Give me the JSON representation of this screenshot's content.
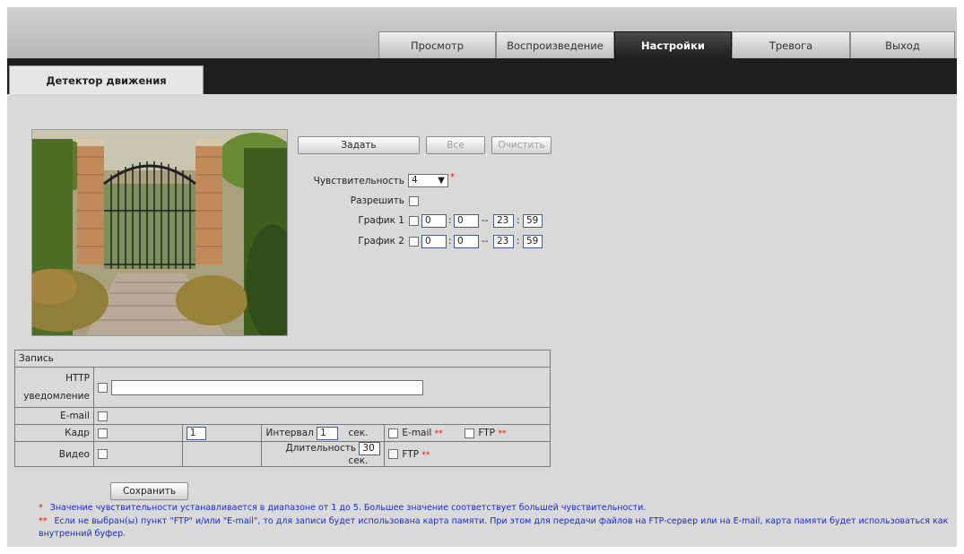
{
  "nav": {
    "tabs": [
      {
        "label": "Просмотр"
      },
      {
        "label": "Воспроизведение"
      },
      {
        "label": "Настройки"
      },
      {
        "label": "Тревога"
      },
      {
        "label": "Выход"
      }
    ],
    "active": "Настройки"
  },
  "page": {
    "tab": "Детектор движения"
  },
  "region_buttons": {
    "set": "Задать",
    "all": "Все",
    "clear": "Очистить"
  },
  "form": {
    "sensitivity_label": "Чувствительность",
    "sensitivity_value": "4",
    "sensitivity_marker": "*",
    "enable_label": "Разрешить",
    "schedule1_label": "График 1",
    "schedule2_label": "График 2",
    "schedule1": {
      "start_h": "0",
      "start_m": "0",
      "end_h": "23",
      "end_m": "59"
    },
    "schedule2": {
      "start_h": "0",
      "start_m": "0",
      "end_h": "23",
      "end_m": "59"
    },
    "colon": ":",
    "dash": "--"
  },
  "record": {
    "header": "Запись",
    "http_label_1": "HTTP",
    "http_label_2": "уведомление",
    "http_value": "",
    "email_label": "E-mail",
    "frame_label": "Кадр",
    "frame_count": "1",
    "interval_label": "Интервал",
    "interval_value": "1",
    "sec": "сек.",
    "email_opt": "E-mail",
    "ftp_opt": "FTP",
    "double_marker": "**",
    "video_label": "Видео",
    "duration_label": "Длительность",
    "duration_value": "30"
  },
  "save_button": "Сохранить",
  "notes": {
    "n1_marker": "*",
    "n1": "Значение чувствительности устанавливается в диапазоне от 1 до 5. Большее значение соответствует большей чувствительности.",
    "n2_marker": "**",
    "n2": "Если не выбран(ы) пункт \"FTP\" и/или \"E-mail\", то для записи будет использована карта памяти. При этом для передачи файлов на FTP-сервер или на E-mail, карта памяти будет использоваться как внутренний буфер."
  },
  "colors": {
    "active_tab": "#1e1e1e",
    "note_text": "#1a2bd0",
    "required_marker": "#e01010"
  }
}
